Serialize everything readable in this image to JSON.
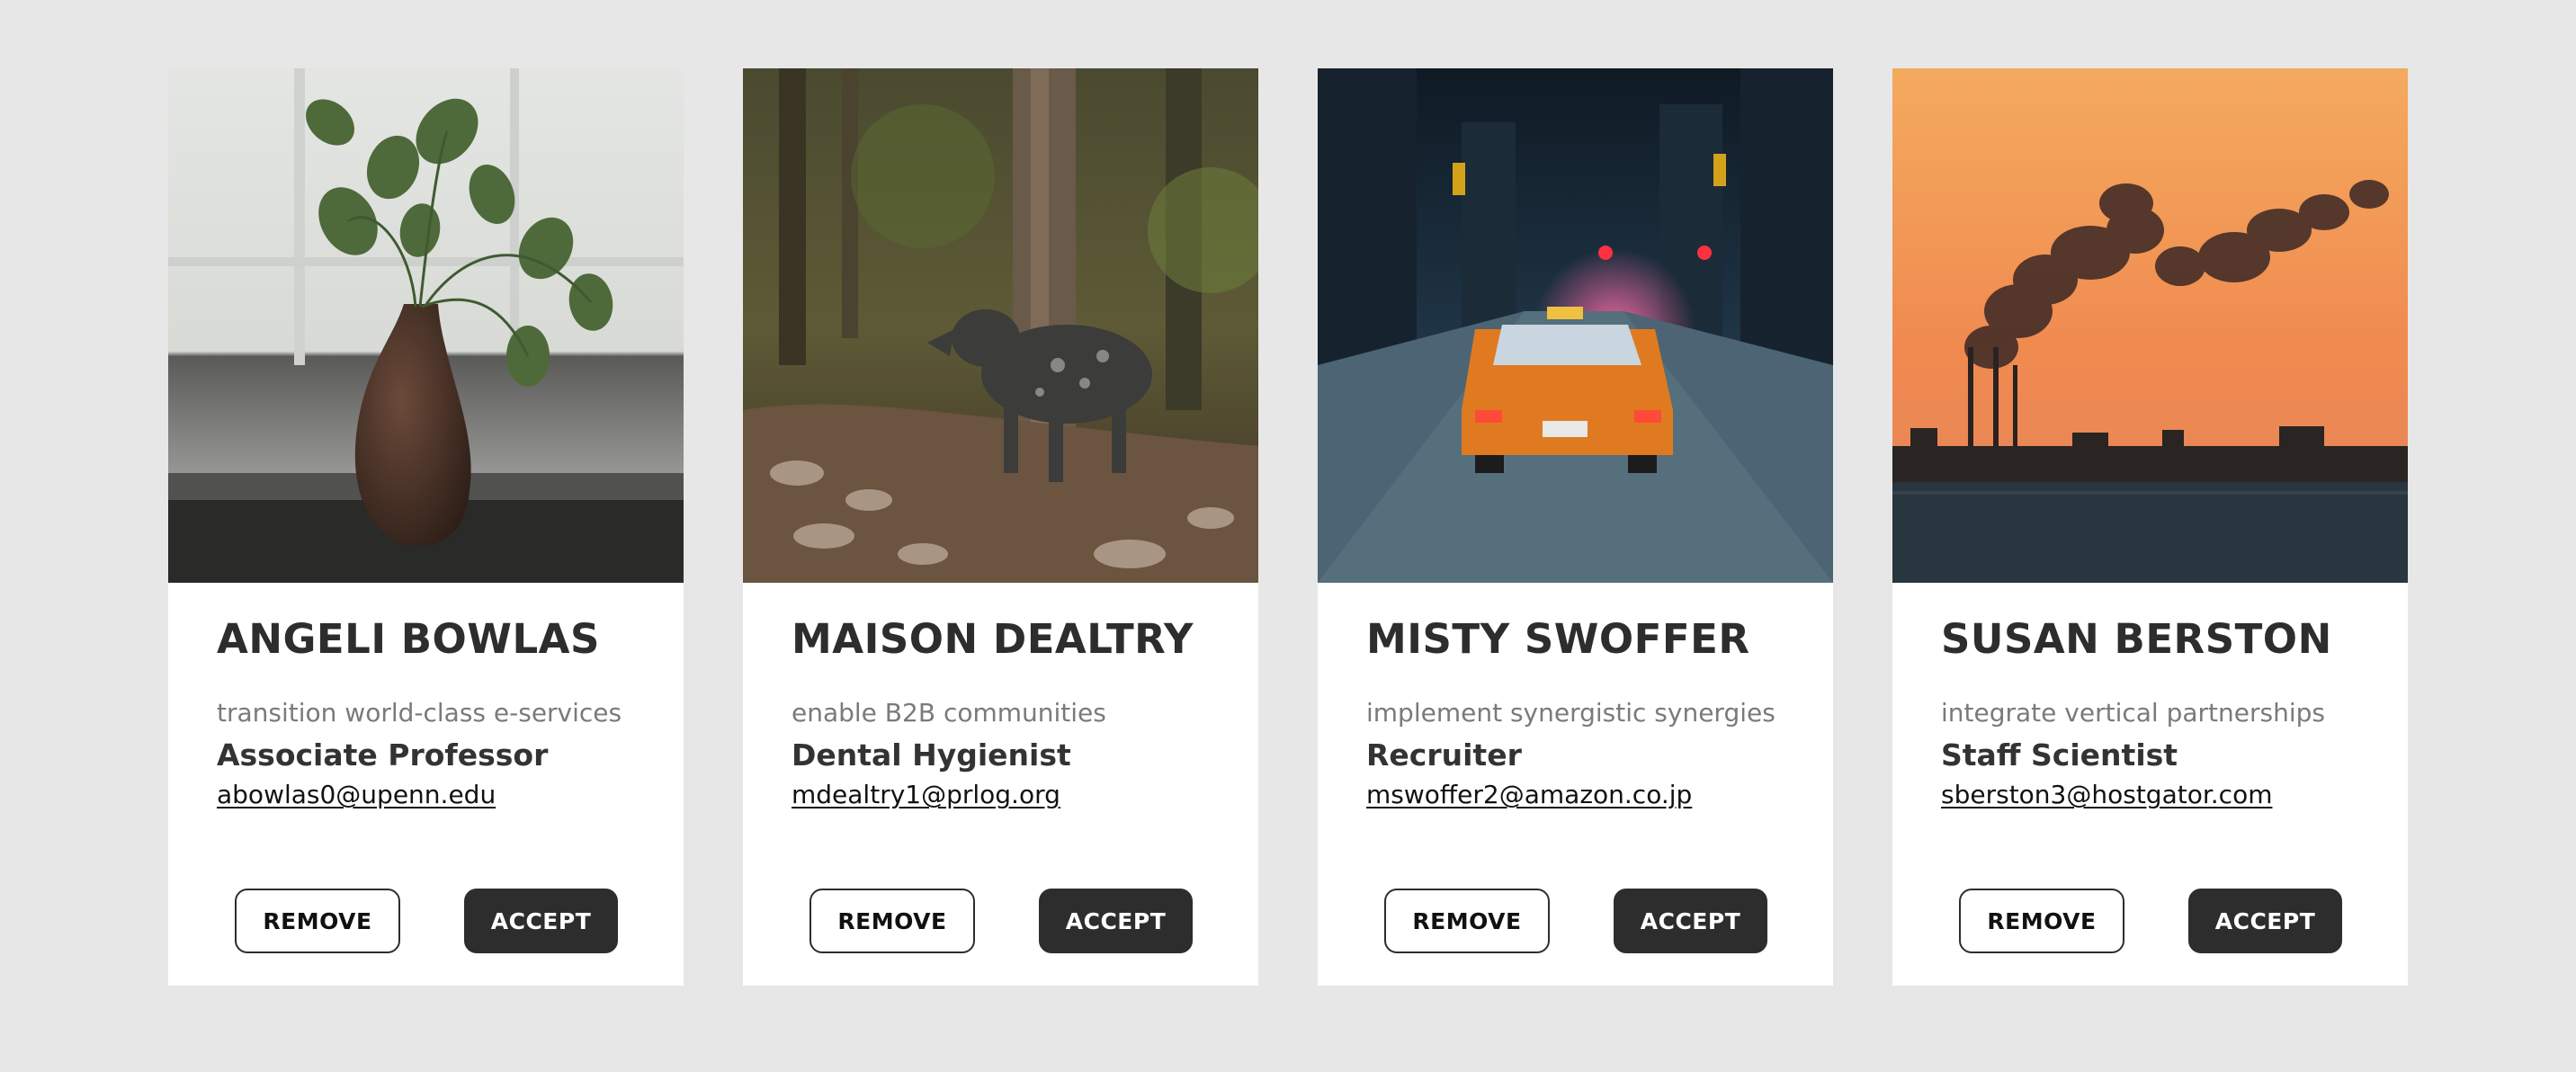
{
  "cards": [
    {
      "name": "ANGELI BOWLAS",
      "tagline": "transition world-class e-services",
      "job_title": "Associate Professor",
      "email": "abowlas0@upenn.edu",
      "photo_subject": "plant-in-vase",
      "remove_label": "REMOVE",
      "accept_label": "ACCEPT"
    },
    {
      "name": "MAISON DEALTRY",
      "tagline": "enable B2B communities",
      "job_title": "Dental Hygienist",
      "email": "mdealtry1@prlog.org",
      "photo_subject": "dog-in-forest",
      "remove_label": "REMOVE",
      "accept_label": "ACCEPT"
    },
    {
      "name": "MISTY SWOFFER",
      "tagline": "implement synergistic synergies",
      "job_title": "Recruiter",
      "email": "mswoffer2@amazon.co.jp",
      "photo_subject": "taxi-snowy-street",
      "remove_label": "REMOVE",
      "accept_label": "ACCEPT"
    },
    {
      "name": "SUSAN BERSTON",
      "tagline": "integrate vertical partnerships",
      "job_title": "Staff Scientist",
      "email": "sberston3@hostgator.com",
      "photo_subject": "factory-smoke-sunset",
      "remove_label": "REMOVE",
      "accept_label": "ACCEPT"
    }
  ],
  "colors": {
    "page_background": "#e7e7e7",
    "card_background": "#ffffff",
    "accent_dark": "#2d2d2d",
    "muted_text": "#7a7a7a"
  }
}
